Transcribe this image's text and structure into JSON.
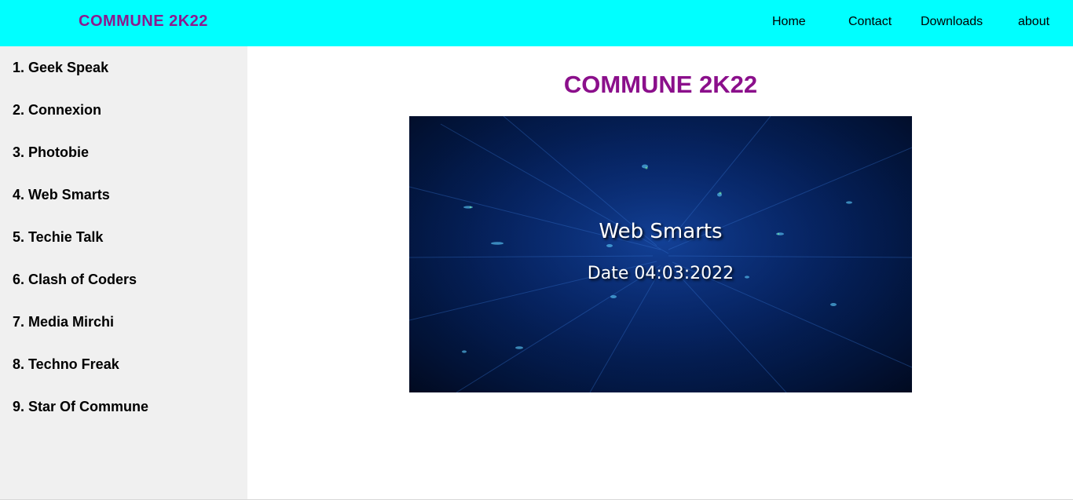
{
  "header": {
    "brand": "COMMUNE 2K22",
    "nav": [
      "Home",
      "Contact",
      "Downloads",
      "about"
    ]
  },
  "sidebar": {
    "items": [
      "1. Geek Speak",
      "2. Connexion",
      "3. Photobie",
      "4. Web Smarts",
      "5. Techie Talk",
      "6. Clash of Coders",
      "7. Media Mirchi",
      "8. Techno Freak",
      "9. Star Of Commune"
    ]
  },
  "main": {
    "title": "COMMUNE 2K22",
    "video": {
      "title": "Web Smarts",
      "date": "Date 04:03:2022"
    }
  },
  "colors": {
    "header_bg": "#00ffff",
    "brand": "#8b1a8f",
    "sidebar_bg": "#f0f0f0",
    "title": "#8b0f8b"
  }
}
